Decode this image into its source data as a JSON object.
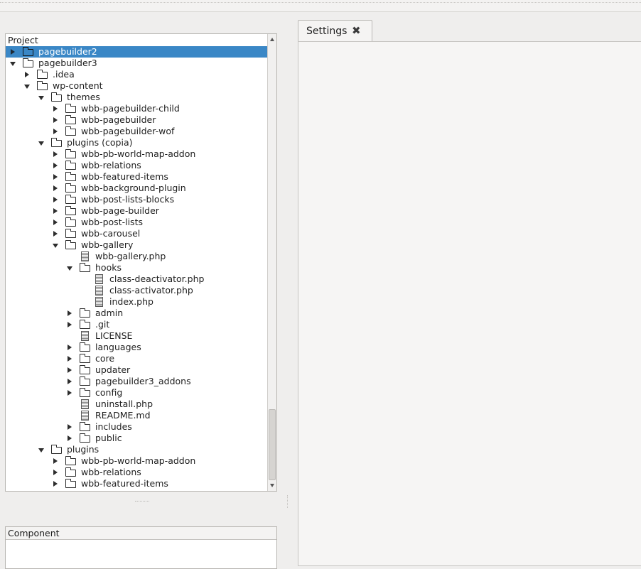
{
  "project_panel": {
    "title": "Project",
    "items": [
      {
        "label": "pagebuilder2",
        "depth": 0,
        "type": "folder",
        "expander": "right",
        "selected": true,
        "icon": "folder-icon"
      },
      {
        "label": "pagebuilder3",
        "depth": 0,
        "type": "folder",
        "expander": "down",
        "icon": "folder-icon"
      },
      {
        "label": ".idea",
        "depth": 1,
        "type": "folder",
        "expander": "right",
        "icon": "folder-icon"
      },
      {
        "label": "wp-content",
        "depth": 1,
        "type": "folder",
        "expander": "down",
        "icon": "folder-icon"
      },
      {
        "label": "themes",
        "depth": 2,
        "type": "folder",
        "expander": "down",
        "icon": "folder-icon"
      },
      {
        "label": "wbb-pagebuilder-child",
        "depth": 3,
        "type": "folder",
        "expander": "right",
        "icon": "folder-icon"
      },
      {
        "label": "wbb-pagebuilder",
        "depth": 3,
        "type": "folder",
        "expander": "right",
        "icon": "folder-icon"
      },
      {
        "label": "wbb-pagebuilder-wof",
        "depth": 3,
        "type": "folder",
        "expander": "right",
        "icon": "folder-icon"
      },
      {
        "label": "plugins (copia)",
        "depth": 2,
        "type": "folder",
        "expander": "down",
        "icon": "folder-icon"
      },
      {
        "label": "wbb-pb-world-map-addon",
        "depth": 3,
        "type": "folder",
        "expander": "right",
        "icon": "folder-icon"
      },
      {
        "label": "wbb-relations",
        "depth": 3,
        "type": "folder",
        "expander": "right",
        "icon": "folder-icon"
      },
      {
        "label": "wbb-featured-items",
        "depth": 3,
        "type": "folder",
        "expander": "right",
        "icon": "folder-icon"
      },
      {
        "label": "wbb-background-plugin",
        "depth": 3,
        "type": "folder",
        "expander": "right",
        "icon": "folder-icon"
      },
      {
        "label": "wbb-post-lists-blocks",
        "depth": 3,
        "type": "folder",
        "expander": "right",
        "icon": "folder-icon"
      },
      {
        "label": "wbb-page-builder",
        "depth": 3,
        "type": "folder",
        "expander": "right",
        "icon": "folder-icon"
      },
      {
        "label": "wbb-post-lists",
        "depth": 3,
        "type": "folder",
        "expander": "right",
        "icon": "folder-icon"
      },
      {
        "label": "wbb-carousel",
        "depth": 3,
        "type": "folder",
        "expander": "right",
        "icon": "folder-icon"
      },
      {
        "label": "wbb-gallery",
        "depth": 3,
        "type": "folder",
        "expander": "down",
        "icon": "folder-icon"
      },
      {
        "label": "wbb-gallery.php",
        "depth": 4,
        "type": "file",
        "expander": "none",
        "icon": "file-icon"
      },
      {
        "label": "hooks",
        "depth": 4,
        "type": "folder",
        "expander": "down",
        "icon": "folder-icon"
      },
      {
        "label": "class-deactivator.php",
        "depth": 5,
        "type": "file",
        "expander": "none",
        "icon": "file-icon"
      },
      {
        "label": "class-activator.php",
        "depth": 5,
        "type": "file",
        "expander": "none",
        "icon": "file-icon"
      },
      {
        "label": "index.php",
        "depth": 5,
        "type": "file",
        "expander": "none",
        "icon": "file-icon"
      },
      {
        "label": "admin",
        "depth": 4,
        "type": "folder",
        "expander": "right",
        "icon": "folder-icon"
      },
      {
        "label": ".git",
        "depth": 4,
        "type": "folder",
        "expander": "right",
        "icon": "folder-icon"
      },
      {
        "label": "LICENSE",
        "depth": 4,
        "type": "file",
        "expander": "none",
        "icon": "file-icon"
      },
      {
        "label": "languages",
        "depth": 4,
        "type": "folder",
        "expander": "right",
        "icon": "folder-icon"
      },
      {
        "label": "core",
        "depth": 4,
        "type": "folder",
        "expander": "right",
        "icon": "folder-icon"
      },
      {
        "label": "updater",
        "depth": 4,
        "type": "folder",
        "expander": "right",
        "icon": "folder-icon"
      },
      {
        "label": "pagebuilder3_addons",
        "depth": 4,
        "type": "folder",
        "expander": "right",
        "icon": "folder-icon"
      },
      {
        "label": "config",
        "depth": 4,
        "type": "folder",
        "expander": "right",
        "icon": "folder-icon"
      },
      {
        "label": "uninstall.php",
        "depth": 4,
        "type": "file",
        "expander": "none",
        "icon": "file-icon"
      },
      {
        "label": "README.md",
        "depth": 4,
        "type": "file",
        "expander": "none",
        "icon": "file-icon"
      },
      {
        "label": "includes",
        "depth": 4,
        "type": "folder",
        "expander": "right",
        "icon": "folder-icon"
      },
      {
        "label": "public",
        "depth": 4,
        "type": "folder",
        "expander": "right",
        "icon": "folder-icon"
      },
      {
        "label": "plugins",
        "depth": 2,
        "type": "folder",
        "expander": "down",
        "icon": "folder-icon"
      },
      {
        "label": "wbb-pb-world-map-addon",
        "depth": 3,
        "type": "folder",
        "expander": "right",
        "icon": "folder-icon"
      },
      {
        "label": "wbb-relations",
        "depth": 3,
        "type": "folder",
        "expander": "right",
        "icon": "folder-icon"
      },
      {
        "label": "wbb-featured-items",
        "depth": 3,
        "type": "folder",
        "expander": "right",
        "icon": "folder-icon"
      }
    ]
  },
  "component_panel": {
    "title": "Component"
  },
  "tabs": [
    {
      "label": "Settings",
      "close_icon": "close-icon",
      "close_glyph": "✖",
      "active": true
    }
  ],
  "colors": {
    "selection": "#3a87c6",
    "background": "#efeeed"
  }
}
